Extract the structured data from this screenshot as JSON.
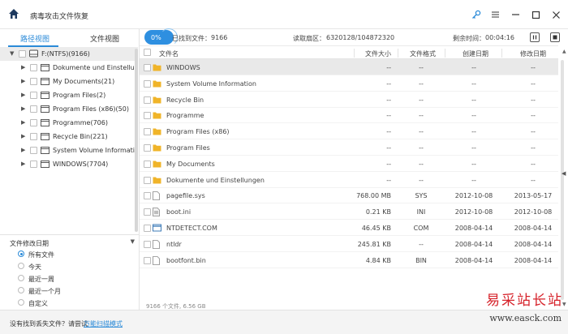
{
  "app": {
    "title": "病毒攻击文件恢复"
  },
  "window_controls": [
    "key-icon",
    "menu-icon",
    "minimize-icon",
    "maximize-icon",
    "close-icon"
  ],
  "left_panel": {
    "tabs": [
      {
        "label": "路径视图",
        "active": true
      },
      {
        "label": "文件视图",
        "active": false
      }
    ],
    "tree": [
      {
        "label": "F:(NTFS)(9166)",
        "root": true,
        "expanded": true
      },
      {
        "label": "Dokumente und Einstellungen"
      },
      {
        "label": "My Documents(21)"
      },
      {
        "label": "Program Files(2)"
      },
      {
        "label": "Program Files (x86)(50)"
      },
      {
        "label": "Programme(706)"
      },
      {
        "label": "Recycle Bin(221)"
      },
      {
        "label": "System Volume Information("
      },
      {
        "label": "WINDOWS(7704)"
      }
    ],
    "filter": {
      "title": "文件修改日期",
      "options": [
        {
          "label": "所有文件",
          "selected": true
        },
        {
          "label": "今天",
          "selected": false
        },
        {
          "label": "最近一周",
          "selected": false
        },
        {
          "label": "最近一个月",
          "selected": false
        },
        {
          "label": "自定义",
          "selected": false
        }
      ]
    }
  },
  "status": {
    "progress_label": "0%",
    "found_label": "已找到文件：",
    "found_value": "9166",
    "sectors_label": "读取扇区：",
    "sectors_value": "6320128/104872320",
    "remaining_label": "剩余时间：",
    "remaining_value": "00:04:16"
  },
  "table": {
    "columns": [
      "文件名",
      "文件大小",
      "文件格式",
      "创建日期",
      "修改日期"
    ],
    "rows": [
      {
        "name": "WINDOWS",
        "size": "--",
        "format": "--",
        "created": "--",
        "modified": "--",
        "type": "folder",
        "selected": true
      },
      {
        "name": "System Volume Information",
        "size": "--",
        "format": "--",
        "created": "--",
        "modified": "--",
        "type": "folder"
      },
      {
        "name": "Recycle Bin",
        "size": "--",
        "format": "--",
        "created": "--",
        "modified": "--",
        "type": "folder"
      },
      {
        "name": "Programme",
        "size": "--",
        "format": "--",
        "created": "--",
        "modified": "--",
        "type": "folder"
      },
      {
        "name": "Program Files (x86)",
        "size": "--",
        "format": "--",
        "created": "--",
        "modified": "--",
        "type": "folder"
      },
      {
        "name": "Program Files",
        "size": "--",
        "format": "--",
        "created": "--",
        "modified": "--",
        "type": "folder"
      },
      {
        "name": "My Documents",
        "size": "--",
        "format": "--",
        "created": "--",
        "modified": "--",
        "type": "folder"
      },
      {
        "name": "Dokumente und Einstellungen",
        "size": "--",
        "format": "--",
        "created": "--",
        "modified": "--",
        "type": "folder"
      },
      {
        "name": "pagefile.sys",
        "size": "768.00 MB",
        "format": "SYS",
        "created": "2012-10-08",
        "modified": "2013-05-17",
        "type": "file"
      },
      {
        "name": "boot.ini",
        "size": "0.21 KB",
        "format": "INI",
        "created": "2012-10-08",
        "modified": "2012-10-08",
        "type": "ini"
      },
      {
        "name": "NTDETECT.COM",
        "size": "46.45 KB",
        "format": "COM",
        "created": "2008-04-14",
        "modified": "2008-04-14",
        "type": "com"
      },
      {
        "name": "ntldr",
        "size": "245.81 KB",
        "format": "--",
        "created": "2008-04-14",
        "modified": "2008-04-14",
        "type": "file"
      },
      {
        "name": "bootfont.bin",
        "size": "4.84 KB",
        "format": "BIN",
        "created": "2008-04-14",
        "modified": "2008-04-14",
        "type": "file"
      }
    ],
    "footer": "9166 个文件, 6.56 GB"
  },
  "bottom": {
    "prompt": "没有找到丢失文件？请尝试",
    "link": "万能扫描模式"
  },
  "watermark": {
    "main": "易采站长站",
    "sub": "www.easck.com"
  },
  "colors": {
    "accent": "#2a8ad8",
    "folder": "#f0b429",
    "watermark": "#d6222a"
  }
}
